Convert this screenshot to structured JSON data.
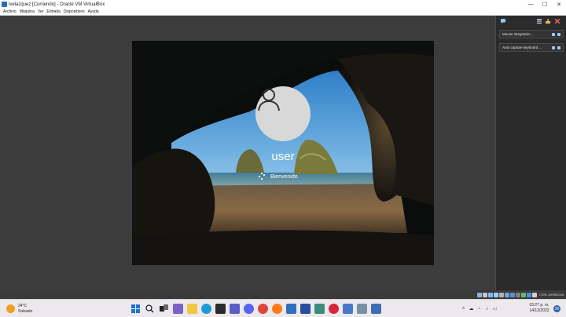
{
  "window": {
    "title": "lvelazquez [Corriendo] - Oracle VM VirtualBox",
    "minimize": "—",
    "maximize": "☐",
    "close": "✕"
  },
  "menu": {
    "items": [
      "Archivo",
      "Máquina",
      "Ver",
      "Entrada",
      "Dispositivos",
      "Ayuda"
    ]
  },
  "guest": {
    "username": "user",
    "welcome_text": "Bienvenido"
  },
  "side_panel": {
    "items": [
      {
        "label": "Mouse integration ..."
      },
      {
        "label": "Auto capture keyboard ..."
      }
    ]
  },
  "status_bar": {
    "host_key": "CTRL DERECHA"
  },
  "taskbar": {
    "weather_temp": "24°C",
    "weather_desc": "Soleado",
    "apps": [
      "start-icon",
      "search-icon",
      "task-view-icon",
      "widgets-icon",
      "chat-icon",
      "file-explorer-icon",
      "edge-icon",
      "store-icon",
      "teams-icon",
      "discord-icon",
      "chrome-icon",
      "firefox-icon",
      "mail-icon",
      "word-icon",
      "photos-icon",
      "opera-icon",
      "virtualbox-icon",
      "vbox-manager-icon",
      "snipping-tool-icon"
    ],
    "time": "03:27 p. m.",
    "date": "14/12/2022",
    "notifications": "20"
  },
  "colors": {
    "accent": "#2563b5",
    "vm_background": "#3c3c3c",
    "taskbar": "#ece9ec"
  }
}
